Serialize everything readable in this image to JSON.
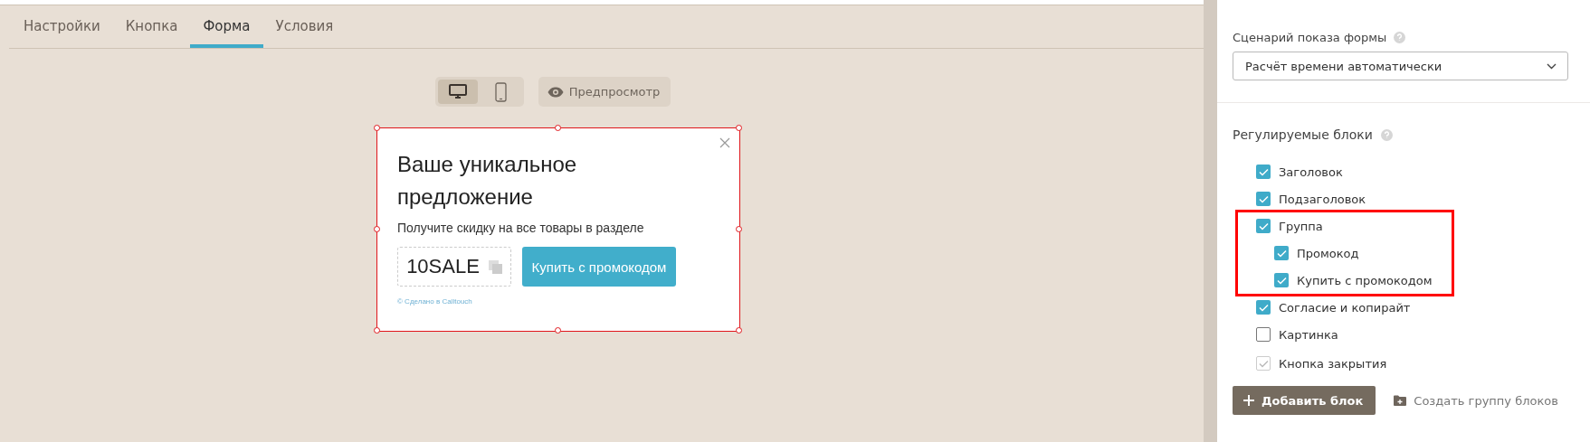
{
  "tabs": [
    {
      "label": "Настройки",
      "selected": false
    },
    {
      "label": "Кнопка",
      "selected": false
    },
    {
      "label": "Форма",
      "selected": true
    },
    {
      "label": "Условия",
      "selected": false
    }
  ],
  "view_modes": [
    {
      "kind": "desktop",
      "selected": true
    },
    {
      "kind": "mobile",
      "selected": false
    }
  ],
  "preview_button": {
    "label": "Предпросмотр"
  },
  "form_preview": {
    "selected": true,
    "title": "Ваше уникальное предложение",
    "subtitle": "Получите скидку на все товары в разделе",
    "promo_code": "10SALE",
    "buy_button": "Купить с промокодом",
    "footer": "© Сделано в Calltouch"
  },
  "settings": {
    "scenario_label": "Сценарий показа формы",
    "scenario_value": "Расчёт времени автоматически",
    "blocks_title": "Регулируемые блоки",
    "blocks": [
      {
        "label": "Заголовок",
        "checked": true,
        "disabled": false,
        "highlighted": false
      },
      {
        "label": "Подзаголовок",
        "checked": true,
        "disabled": false,
        "highlighted": false
      },
      {
        "label": "Группа",
        "checked": true,
        "disabled": false,
        "highlighted": true,
        "children": [
          {
            "label": "Промокод",
            "checked": true,
            "disabled": false
          },
          {
            "label": "Купить с промокодом",
            "checked": true,
            "disabled": false
          }
        ]
      },
      {
        "label": "Согласие и копирайт",
        "checked": true,
        "disabled": false,
        "highlighted": false
      },
      {
        "label": "Картинка",
        "checked": false,
        "disabled": false,
        "highlighted": false
      },
      {
        "label": "Кнопка закрытия",
        "checked": true,
        "disabled": true,
        "highlighted": false
      }
    ],
    "add_button": "Добавить блок",
    "create_group_link": "Создать группу блоков"
  }
}
